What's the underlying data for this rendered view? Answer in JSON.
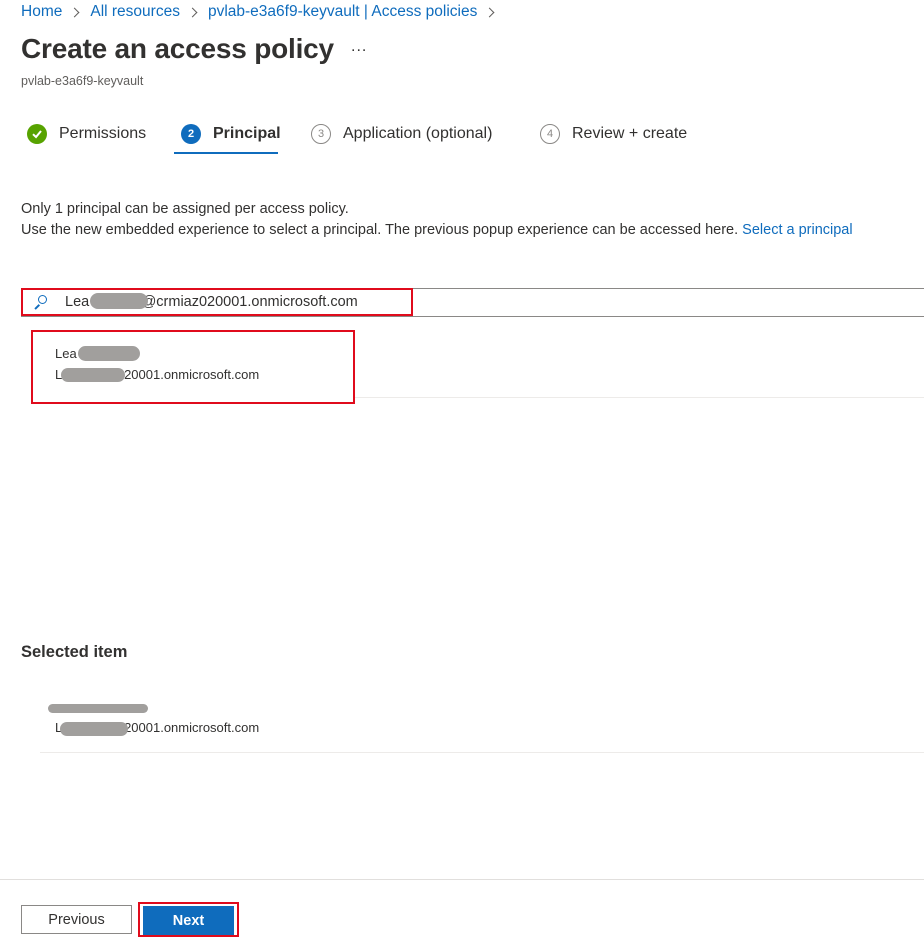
{
  "breadcrumb": {
    "home": "Home",
    "all_resources": "All resources",
    "vault": "pvlab-e3a6f9-keyvault | Access policies"
  },
  "header": {
    "title": "Create an access policy",
    "more": "...",
    "subtitle": "pvlab-e3a6f9-keyvault"
  },
  "steps": [
    {
      "number": "",
      "label": "Permissions",
      "state": "done"
    },
    {
      "number": "2",
      "label": "Principal",
      "state": "active"
    },
    {
      "number": "3",
      "label": "Application (optional)",
      "state": "todo"
    },
    {
      "number": "4",
      "label": "Review + create",
      "state": "todo"
    }
  ],
  "info": {
    "line1": "Only 1 principal can be assigned per access policy.",
    "line2": "Use the new embedded experience to select a principal. The previous popup experience can be accessed here.",
    "link": "Select a principal"
  },
  "search": {
    "value": "Lea             @crmiaz020001.onmicrosoft.com"
  },
  "result": {
    "name": "Lea",
    "email": "L                @crmiaz020001.onmicrosoft.com"
  },
  "selected": {
    "title": "Selected item",
    "name": "",
    "email": "L                @crmiaz020001.onmicrosoft.com"
  },
  "footer": {
    "previous": "Previous",
    "next": "Next"
  },
  "colors": {
    "accent": "#0f6cbd",
    "success": "#57a300",
    "highlight": "#e00b1c"
  }
}
